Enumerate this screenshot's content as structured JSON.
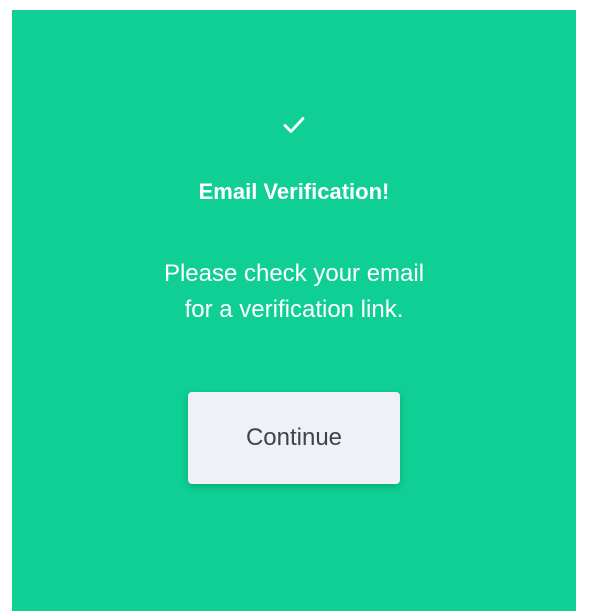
{
  "colors": {
    "card_background": "#10cf94",
    "text": "#ffffff",
    "button_background": "#eef1f6",
    "button_text": "#3d4450"
  },
  "icon": {
    "name": "checkmark-icon"
  },
  "title": "Email Verification!",
  "message": {
    "line1": "Please check your email",
    "line2": "for a verification link."
  },
  "button": {
    "label": "Continue"
  }
}
